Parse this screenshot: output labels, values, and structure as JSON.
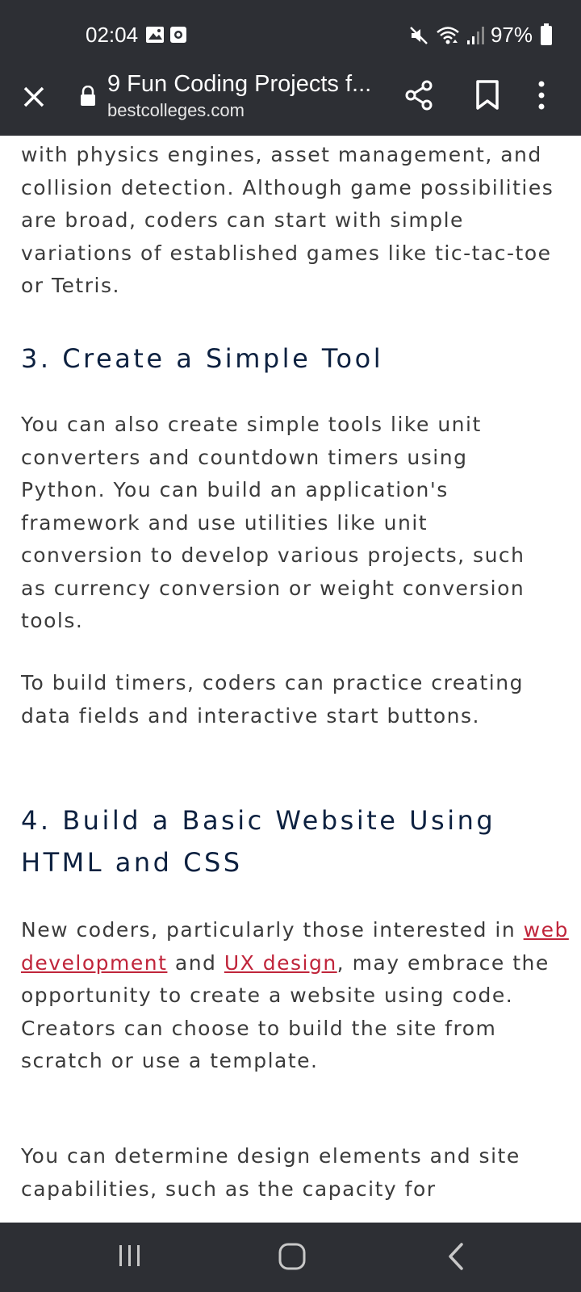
{
  "status_bar": {
    "time": "02:04",
    "battery": "97%",
    "icons": [
      "image-icon",
      "screen-record-icon",
      "mute-icon",
      "wifi-icon",
      "signal-icon",
      "battery-icon"
    ]
  },
  "toolbar": {
    "title": "9 Fun Coding Projects f...",
    "domain": "bestcolleges.com",
    "icons": [
      "close-icon",
      "lock-icon",
      "share-icon",
      "bookmark-icon",
      "more-options-icon"
    ]
  },
  "article": {
    "para1": "with physics engines, asset management, and collision detection. Although game possibilities are broad, coders can start with simple variations of established games like tic-tac-toe or Tetris.",
    "heading3": "3. Create a Simple Tool",
    "para2": "You can also create simple tools like unit converters and countdown timers using Python. You can build an application's framework and use utilities like unit conversion to develop various projects, such as currency conversion or weight conversion tools.",
    "para3": "To build timers, coders can practice creating data fields and interactive start buttons.",
    "heading4": "4. Build a Basic Website Using HTML and CSS",
    "para4_before": "New coders, particularly those interested in ",
    "link_web_dev": "web development",
    "para4_mid": " and ",
    "link_ux": "UX design",
    "para4_after": ", may embrace the opportunity to create a website using code. Creators can choose to build the site from scratch or use a template.",
    "para5": "You can determine design elements and site capabilities, such as the capacity for"
  },
  "nav_bar": {
    "icons": [
      "recent-apps-icon",
      "home-icon",
      "back-icon"
    ]
  },
  "colors": {
    "chrome_bg": "#2d2f34",
    "heading": "#0d2140",
    "body_text": "#3b3b3b",
    "link": "#c0253b"
  }
}
